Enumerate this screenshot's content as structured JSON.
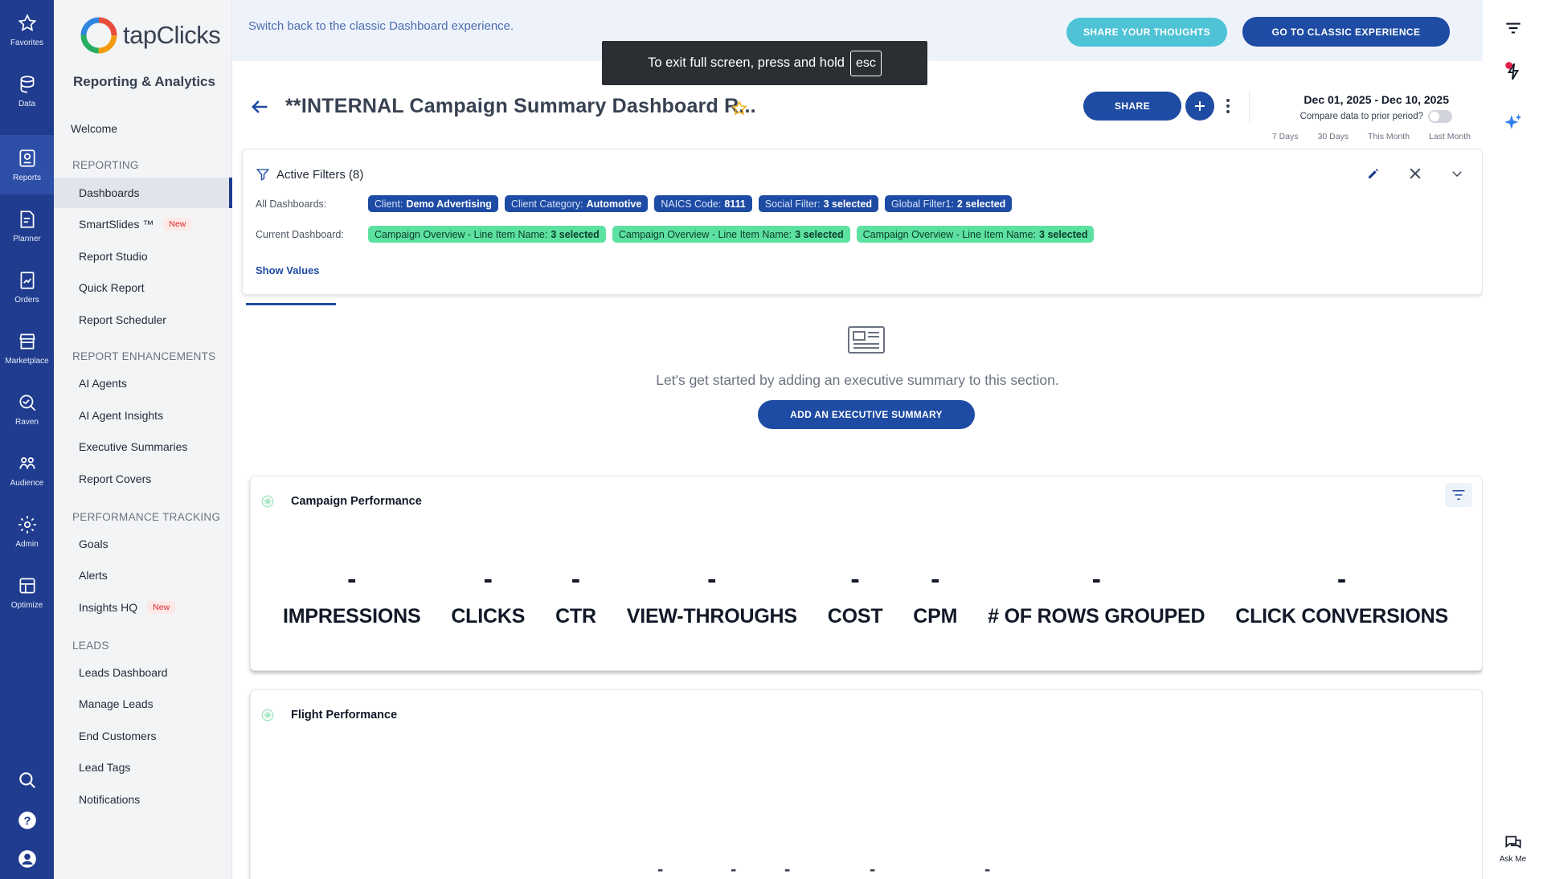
{
  "rail": {
    "items": [
      {
        "label": "Favorites"
      },
      {
        "label": "Data"
      },
      {
        "label": "Reports"
      },
      {
        "label": "Planner"
      },
      {
        "label": "Orders"
      },
      {
        "label": "Marketplace"
      },
      {
        "label": "Raven"
      },
      {
        "label": "Audience"
      },
      {
        "label": "Admin"
      },
      {
        "label": "Optimize"
      }
    ]
  },
  "nav": {
    "brand": "tapClicks",
    "subtitle": "Reporting & Analytics",
    "welcome": "Welcome",
    "sections": [
      {
        "heading": "REPORTING",
        "items": [
          "Dashboards",
          "SmartSlides ™",
          "Report Studio",
          "Quick Report",
          "Report Scheduler"
        ]
      },
      {
        "heading": "REPORT ENHANCEMENTS",
        "items": [
          "AI Agents",
          "AI Agent Insights",
          "Executive Summaries",
          "Report Covers"
        ]
      },
      {
        "heading": "PERFORMANCE TRACKING",
        "items": [
          "Goals",
          "Alerts",
          "Insights HQ"
        ]
      },
      {
        "heading": "LEADS",
        "items": [
          "Leads Dashboard",
          "Manage Leads",
          "End Customers",
          "Lead Tags",
          "Notifications"
        ]
      }
    ],
    "new_badge": "New"
  },
  "banner": {
    "text": "Switch back to the classic Dashboard experience.",
    "share_thoughts": "SHARE YOUR THOUGHTS",
    "classic": "GO TO CLASSIC EXPERIENCE"
  },
  "toast": {
    "text": "To exit full screen, press and hold",
    "key": "esc"
  },
  "header": {
    "title": "**INTERNAL Campaign Summary Dashboard R...",
    "share": "SHARE",
    "date_range": "Dec 01, 2025 - Dec 10, 2025",
    "compare": "Compare data to prior period?",
    "quick_dates": [
      "7 Days",
      "30 Days",
      "This Month",
      "Last Month"
    ]
  },
  "filters": {
    "title": "Active Filters (8)",
    "all_label": "All Dashboards:",
    "current_label": "Current Dashboard:",
    "all": [
      {
        "key": "Client:",
        "value": "Demo Advertising"
      },
      {
        "key": "Client Category:",
        "value": "Automotive"
      },
      {
        "key": "NAICS Code:",
        "value": "8111"
      },
      {
        "key": "Social Filter:",
        "value": "3 selected"
      },
      {
        "key": "Global Filter1:",
        "value": "2 selected"
      }
    ],
    "current": [
      {
        "key": "Campaign Overview - Line Item Name:",
        "value": "3 selected"
      },
      {
        "key": "Campaign Overview - Line Item Name:",
        "value": "3 selected"
      },
      {
        "key": "Campaign Overview - Line Item Name:",
        "value": "3 selected"
      }
    ],
    "show_values": "Show Values"
  },
  "summary": {
    "empty_text": "Let's get started by adding an executive summary to this section.",
    "button": "ADD AN EXECUTIVE SUMMARY"
  },
  "campaign": {
    "title": "Campaign Performance",
    "metrics": [
      {
        "value": "-",
        "label": "IMPRESSIONS"
      },
      {
        "value": "-",
        "label": "CLICKS"
      },
      {
        "value": "-",
        "label": "CTR"
      },
      {
        "value": "-",
        "label": "VIEW-THROUGHS"
      },
      {
        "value": "-",
        "label": "COST"
      },
      {
        "value": "-",
        "label": "CPM"
      },
      {
        "value": "-",
        "label": "# OF ROWS GROUPED"
      },
      {
        "value": "-",
        "label": "CLICK CONVERSIONS"
      }
    ]
  },
  "flight": {
    "title": "Flight Performance",
    "values": [
      "-",
      "-",
      "-",
      "-",
      "-"
    ]
  },
  "right_rail": {
    "ask_me": "Ask Me"
  },
  "colors": {
    "primary": "#1e4ba3",
    "rail": "#1f3c8f",
    "teal": "#4fc3d6",
    "green_chip": "#5de1a0"
  }
}
